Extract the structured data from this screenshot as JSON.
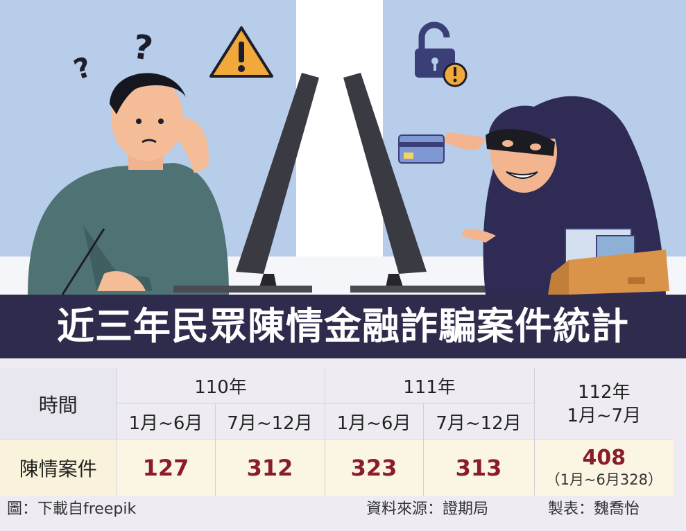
{
  "title": "近三年民眾陳情金融詐騙案件統計",
  "table": {
    "time_header": "時間",
    "years": [
      {
        "label": "110年",
        "periods": [
          "1月~6月",
          "7月~12月"
        ]
      },
      {
        "label": "111年",
        "periods": [
          "1月~6月",
          "7月~12月"
        ]
      }
    ],
    "year_112": {
      "label": "112年",
      "period": "1月~7月"
    },
    "row_label": "陳情案件",
    "values": [
      "127",
      "312",
      "323",
      "313"
    ],
    "value_112": "408",
    "value_112_note": "（1月~6月328）"
  },
  "footer": {
    "image_credit": "圖：下載自freepik",
    "source": "資料來源：證期局",
    "maker": "製表：魏喬怡"
  },
  "colors": {
    "title_band": "#2f2b4d",
    "wall": "#b7cde9",
    "number": "#8a1c2b",
    "cases_row": "#fbf6e4"
  },
  "icons": [
    "question-marks-icon",
    "warning-triangle-icon",
    "padlock-warning-icon",
    "credit-card-icon"
  ]
}
